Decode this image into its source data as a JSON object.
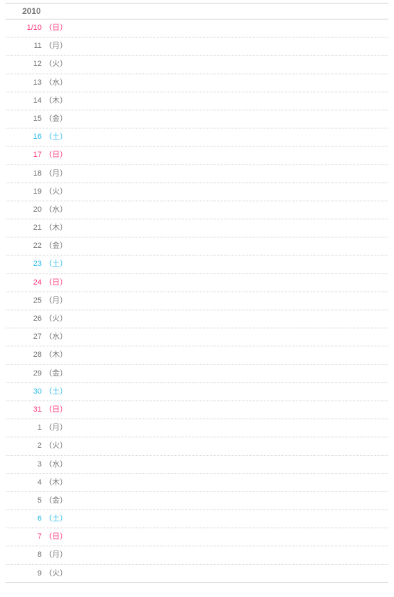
{
  "header": {
    "year": "2010"
  },
  "dow_labels": {
    "sun": "（日）",
    "mon": "（月）",
    "tue": "（火）",
    "wed": "（水）",
    "thu": "（木）",
    "fri": "（金）",
    "sat": "（土）"
  },
  "rows": [
    {
      "date": "1/10",
      "dow": "sun"
    },
    {
      "date": "11",
      "dow": "mon"
    },
    {
      "date": "12",
      "dow": "tue"
    },
    {
      "date": "13",
      "dow": "wed"
    },
    {
      "date": "14",
      "dow": "thu"
    },
    {
      "date": "15",
      "dow": "fri"
    },
    {
      "date": "16",
      "dow": "sat"
    },
    {
      "date": "17",
      "dow": "sun"
    },
    {
      "date": "18",
      "dow": "mon"
    },
    {
      "date": "19",
      "dow": "tue"
    },
    {
      "date": "20",
      "dow": "wed"
    },
    {
      "date": "21",
      "dow": "thu"
    },
    {
      "date": "22",
      "dow": "fri"
    },
    {
      "date": "23",
      "dow": "sat"
    },
    {
      "date": "24",
      "dow": "sun"
    },
    {
      "date": "25",
      "dow": "mon"
    },
    {
      "date": "26",
      "dow": "tue"
    },
    {
      "date": "27",
      "dow": "wed"
    },
    {
      "date": "28",
      "dow": "thu"
    },
    {
      "date": "29",
      "dow": "fri"
    },
    {
      "date": "30",
      "dow": "sat"
    },
    {
      "date": "31",
      "dow": "sun"
    },
    {
      "date": "1",
      "dow": "mon"
    },
    {
      "date": "2",
      "dow": "tue"
    },
    {
      "date": "3",
      "dow": "wed"
    },
    {
      "date": "4",
      "dow": "thu"
    },
    {
      "date": "5",
      "dow": "fri"
    },
    {
      "date": "6",
      "dow": "sat"
    },
    {
      "date": "7",
      "dow": "sun"
    },
    {
      "date": "8",
      "dow": "mon"
    },
    {
      "date": "9",
      "dow": "tue"
    }
  ]
}
